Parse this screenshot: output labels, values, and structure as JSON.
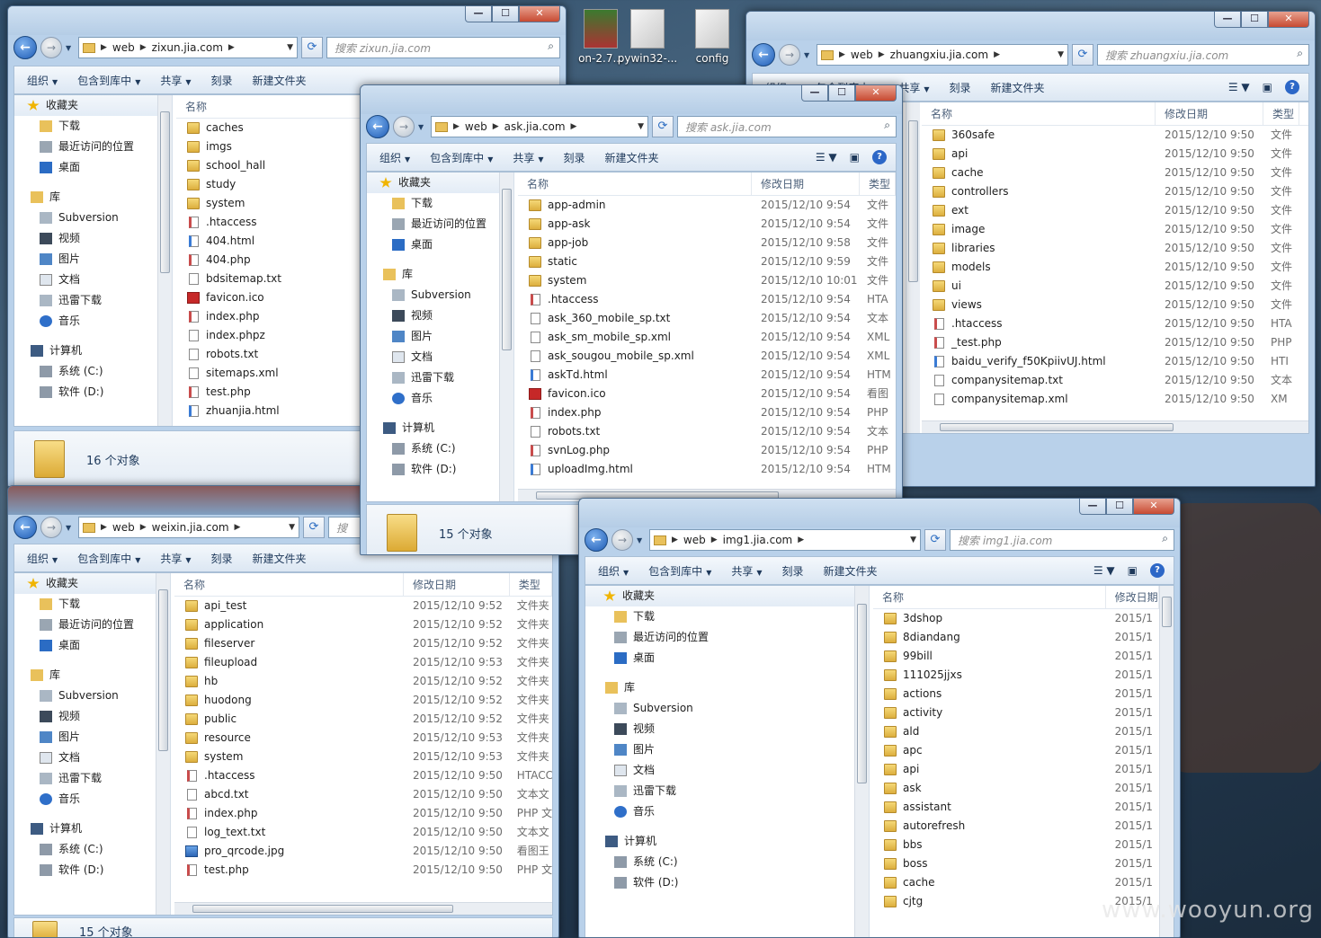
{
  "desktop": {
    "icons": [
      {
        "label": "on-2.7..."
      },
      {
        "label": "pywin32-..."
      },
      {
        "label": "config"
      }
    ],
    "watermark": "www.wooyun.org"
  },
  "sidebar": {
    "favorites": "收藏夹",
    "fav_items": [
      "下载",
      "最近访问的位置",
      "桌面"
    ],
    "library": "库",
    "lib_items": [
      "Subversion",
      "视频",
      "图片",
      "文档",
      "迅雷下载",
      "音乐"
    ],
    "computer": "计算机",
    "comp_items": [
      "系统 (C:)",
      "软件 (D:)"
    ]
  },
  "toolbar": {
    "organize": "组织",
    "include": "包含到库中",
    "share": "共享",
    "burn": "刻录",
    "new_folder": "新建文件夹"
  },
  "columns": {
    "name": "名称",
    "date": "修改日期",
    "type": "类型"
  },
  "windows": {
    "zixun": {
      "path": [
        "web",
        "zixun.jia.com"
      ],
      "search": "搜索 zixun.jia.com",
      "status": "16 个对象",
      "files": [
        {
          "n": "caches",
          "k": "folder"
        },
        {
          "n": "imgs",
          "k": "folder"
        },
        {
          "n": "school_hall",
          "k": "folder"
        },
        {
          "n": "study",
          "k": "folder"
        },
        {
          "n": "system",
          "k": "folder"
        },
        {
          "n": ".htaccess",
          "k": "php"
        },
        {
          "n": "404.html",
          "k": "html"
        },
        {
          "n": "404.php",
          "k": "php"
        },
        {
          "n": "bdsitemap.txt",
          "k": "file"
        },
        {
          "n": "favicon.ico",
          "k": "ico"
        },
        {
          "n": "index.php",
          "k": "php"
        },
        {
          "n": "index.phpz",
          "k": "file"
        },
        {
          "n": "robots.txt",
          "k": "file"
        },
        {
          "n": "sitemaps.xml",
          "k": "file"
        },
        {
          "n": "test.php",
          "k": "php"
        },
        {
          "n": "zhuanjia.html",
          "k": "html"
        }
      ]
    },
    "ask": {
      "path": [
        "web",
        "ask.jia.com"
      ],
      "search": "搜索 ask.jia.com",
      "status": "15 个对象",
      "files": [
        {
          "n": "app-admin",
          "d": "2015/12/10 9:54",
          "t": "文件",
          "k": "folder"
        },
        {
          "n": "app-ask",
          "d": "2015/12/10 9:54",
          "t": "文件",
          "k": "folder"
        },
        {
          "n": "app-job",
          "d": "2015/12/10 9:58",
          "t": "文件",
          "k": "folder"
        },
        {
          "n": "static",
          "d": "2015/12/10 9:59",
          "t": "文件",
          "k": "folder"
        },
        {
          "n": "system",
          "d": "2015/12/10 10:01",
          "t": "文件",
          "k": "folder"
        },
        {
          "n": ".htaccess",
          "d": "2015/12/10 9:54",
          "t": "HTA",
          "k": "php"
        },
        {
          "n": "ask_360_mobile_sp.txt",
          "d": "2015/12/10 9:54",
          "t": "文本",
          "k": "file"
        },
        {
          "n": "ask_sm_mobile_sp.xml",
          "d": "2015/12/10 9:54",
          "t": "XML",
          "k": "file"
        },
        {
          "n": "ask_sougou_mobile_sp.xml",
          "d": "2015/12/10 9:54",
          "t": "XML",
          "k": "file"
        },
        {
          "n": "askTd.html",
          "d": "2015/12/10 9:54",
          "t": "HTM",
          "k": "html"
        },
        {
          "n": "favicon.ico",
          "d": "2015/12/10 9:54",
          "t": "看图",
          "k": "ico"
        },
        {
          "n": "index.php",
          "d": "2015/12/10 9:54",
          "t": "PHP",
          "k": "php"
        },
        {
          "n": "robots.txt",
          "d": "2015/12/10 9:54",
          "t": "文本",
          "k": "file"
        },
        {
          "n": "svnLog.php",
          "d": "2015/12/10 9:54",
          "t": "PHP",
          "k": "php"
        },
        {
          "n": "uploadImg.html",
          "d": "2015/12/10 9:54",
          "t": "HTM",
          "k": "html"
        }
      ]
    },
    "zhuangxiu": {
      "path": [
        "web",
        "zhuangxiu.jia.com"
      ],
      "search": "搜索 zhuangxiu.jia.com",
      "files": [
        {
          "n": "360safe",
          "d": "2015/12/10 9:50",
          "t": "文件",
          "k": "folder"
        },
        {
          "n": "api",
          "d": "2015/12/10 9:50",
          "t": "文件",
          "k": "folder"
        },
        {
          "n": "cache",
          "d": "2015/12/10 9:50",
          "t": "文件",
          "k": "folder"
        },
        {
          "n": "controllers",
          "d": "2015/12/10 9:50",
          "t": "文件",
          "k": "folder"
        },
        {
          "n": "ext",
          "d": "2015/12/10 9:50",
          "t": "文件",
          "k": "folder"
        },
        {
          "n": "image",
          "d": "2015/12/10 9:50",
          "t": "文件",
          "k": "folder"
        },
        {
          "n": "libraries",
          "d": "2015/12/10 9:50",
          "t": "文件",
          "k": "folder"
        },
        {
          "n": "models",
          "d": "2015/12/10 9:50",
          "t": "文件",
          "k": "folder"
        },
        {
          "n": "ui",
          "d": "2015/12/10 9:50",
          "t": "文件",
          "k": "folder"
        },
        {
          "n": "views",
          "d": "2015/12/10 9:50",
          "t": "文件",
          "k": "folder"
        },
        {
          "n": ".htaccess",
          "d": "2015/12/10 9:50",
          "t": "HTA",
          "k": "php"
        },
        {
          "n": "_test.php",
          "d": "2015/12/10 9:50",
          "t": "PHP",
          "k": "php"
        },
        {
          "n": "baidu_verify_f50KpiivUJ.html",
          "d": "2015/12/10 9:50",
          "t": "HTI",
          "k": "html"
        },
        {
          "n": "companysitemap.txt",
          "d": "2015/12/10 9:50",
          "t": "文本",
          "k": "file"
        },
        {
          "n": "companysitemap.xml",
          "d": "2015/12/10 9:50",
          "t": "XM",
          "k": "file"
        }
      ]
    },
    "weixin": {
      "path": [
        "web",
        "weixin.jia.com"
      ],
      "search": "搜",
      "status": "15 个对象",
      "files": [
        {
          "n": "api_test",
          "d": "2015/12/10 9:52",
          "t": "文件夹",
          "k": "folder"
        },
        {
          "n": "application",
          "d": "2015/12/10 9:52",
          "t": "文件夹",
          "k": "folder"
        },
        {
          "n": "fileserver",
          "d": "2015/12/10 9:52",
          "t": "文件夹",
          "k": "folder"
        },
        {
          "n": "fileupload",
          "d": "2015/12/10 9:53",
          "t": "文件夹",
          "k": "folder"
        },
        {
          "n": "hb",
          "d": "2015/12/10 9:52",
          "t": "文件夹",
          "k": "folder"
        },
        {
          "n": "huodong",
          "d": "2015/12/10 9:52",
          "t": "文件夹",
          "k": "folder"
        },
        {
          "n": "public",
          "d": "2015/12/10 9:52",
          "t": "文件夹",
          "k": "folder"
        },
        {
          "n": "resource",
          "d": "2015/12/10 9:53",
          "t": "文件夹",
          "k": "folder"
        },
        {
          "n": "system",
          "d": "2015/12/10 9:53",
          "t": "文件夹",
          "k": "folder"
        },
        {
          "n": ".htaccess",
          "d": "2015/12/10 9:50",
          "t": "HTACC",
          "k": "php"
        },
        {
          "n": "abcd.txt",
          "d": "2015/12/10 9:50",
          "t": "文本文",
          "k": "file"
        },
        {
          "n": "index.php",
          "d": "2015/12/10 9:50",
          "t": "PHP 文",
          "k": "php"
        },
        {
          "n": "log_text.txt",
          "d": "2015/12/10 9:50",
          "t": "文本文",
          "k": "file"
        },
        {
          "n": "pro_qrcode.jpg",
          "d": "2015/12/10 9:50",
          "t": "看图王",
          "k": "img"
        },
        {
          "n": "test.php",
          "d": "2015/12/10 9:50",
          "t": "PHP 文",
          "k": "php"
        }
      ]
    },
    "img1": {
      "path": [
        "web",
        "img1.jia.com"
      ],
      "search": "搜索 img1.jia.com",
      "files": [
        {
          "n": "3dshop",
          "d": "2015/1",
          "k": "folder"
        },
        {
          "n": "8diandang",
          "d": "2015/1",
          "k": "folder"
        },
        {
          "n": "99bill",
          "d": "2015/1",
          "k": "folder"
        },
        {
          "n": "111025jjxs",
          "d": "2015/1",
          "k": "folder"
        },
        {
          "n": "actions",
          "d": "2015/1",
          "k": "folder"
        },
        {
          "n": "activity",
          "d": "2015/1",
          "k": "folder"
        },
        {
          "n": "ald",
          "d": "2015/1",
          "k": "folder"
        },
        {
          "n": "apc",
          "d": "2015/1",
          "k": "folder"
        },
        {
          "n": "api",
          "d": "2015/1",
          "k": "folder"
        },
        {
          "n": "ask",
          "d": "2015/1",
          "k": "folder"
        },
        {
          "n": "assistant",
          "d": "2015/1",
          "k": "folder"
        },
        {
          "n": "autorefresh",
          "d": "2015/1",
          "k": "folder"
        },
        {
          "n": "bbs",
          "d": "2015/1",
          "k": "folder"
        },
        {
          "n": "boss",
          "d": "2015/1",
          "k": "folder"
        },
        {
          "n": "cache",
          "d": "2015/1",
          "k": "folder"
        },
        {
          "n": "cjtg",
          "d": "2015/1",
          "k": "folder"
        }
      ]
    }
  }
}
